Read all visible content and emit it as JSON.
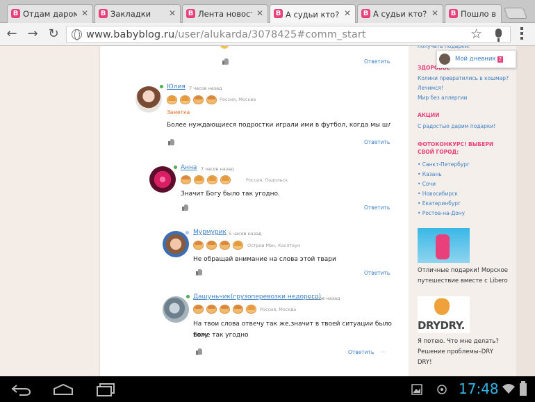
{
  "tabs": [
    {
      "label": "Отдам даром"
    },
    {
      "label": "Закладки"
    },
    {
      "label": "Лента новостей"
    },
    {
      "label": "А судьи кто?"
    },
    {
      "label": "А судьи кто?"
    },
    {
      "label": "Пошло в"
    }
  ],
  "toolbar": {
    "url_main": "www.babyblog.ru",
    "url_path": "/user/alukarda/3078425#comm_start"
  },
  "comments": [
    {
      "name": "Юлия",
      "time": "7 часов назад",
      "location": "Россия, Москва",
      "tag": "Заметка",
      "text": "Более нуждающиеся подростки играли ими в футбол, когда мы шли домой",
      "reply": "Ответить"
    },
    {
      "name": "Анна",
      "time": "7 часов назад",
      "location": "Россия, Подольск",
      "text": "Значит Богу было так угодно.",
      "reply": "Ответить"
    },
    {
      "name": "Мурмурик",
      "time": "5 часов назад",
      "location": "Остров Мэн, Каслтаун",
      "text": "Не обращай внимание на слова этой твари",
      "reply": "Ответить"
    },
    {
      "name": "Дашуньчик(грузоперевозки недорого)",
      "time": "3 часов назад",
      "location": "Россия, Москва",
      "text_line1": "На твои слова отвечу так же,значит в твоей ситуации было Богу",
      "text_line2": "тоже так угодно",
      "reply": "Ответить",
      "more": "···"
    }
  ],
  "top_reply": "Ответить",
  "sidebar": {
    "cut_link": "получать подарки!",
    "diary_label": "Мой дневник",
    "diary_count": "2",
    "health_title": "ЗДОРОВЬЕ",
    "health_links": [
      "Колики превратились в кошмар?",
      "Лечимся!",
      "Мир без аллергии"
    ],
    "promo_title": "АКЦИИ",
    "promo_link": "С радостью дарим подарки!",
    "contest_title_1": "ФОТОКОНКУРС! ВЫБЕРИ",
    "contest_title_2": "СВОЙ ГОРОД:",
    "cities": [
      "• Санкт-Петербург",
      "• Казань",
      "• Сочи",
      "• Новосибирск",
      "• Екатеринбург",
      "• Ростов-на-Дону"
    ],
    "ad1_line1": "Отличные подарки! Морское",
    "ad1_line2": "путешествие вместе с Libero",
    "ad2_logo": "DRYDRY.",
    "ad2_line1": "Я потею. Что мне делать?",
    "ad2_line2": "Решение проблемы–DRY",
    "ad2_line3": "DRY!"
  },
  "system": {
    "clock": "17:48"
  },
  "colors": {
    "accent_pink": "#e8407a",
    "link_blue": "#3b7fc4",
    "clock_blue": "#33b5e5"
  }
}
